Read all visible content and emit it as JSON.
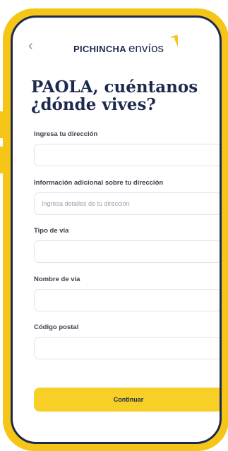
{
  "header": {
    "back_icon": "chevron-left-icon",
    "brand_main": "PICHINCHA",
    "brand_sub": "envíos",
    "accent_color": "#f5c518",
    "ink_color": "#1d2a4d"
  },
  "title": {
    "line1": "PAOLA, cuéntanos",
    "line2": "¿dónde vives?"
  },
  "form": {
    "address_label": "Ingresa tu dirección",
    "address_value": "",
    "extra_label": "Información adicional sobre tu dirección",
    "extra_placeholder": "Ingresa detalles de tu dirección",
    "road_type_label": "Tipo de vía",
    "road_type_value": "",
    "road_name_label": "Nombre de vía",
    "road_name_value": "",
    "postal_label": "Código postal",
    "postal_value": ""
  },
  "actions": {
    "continue_label": "Continuar"
  }
}
